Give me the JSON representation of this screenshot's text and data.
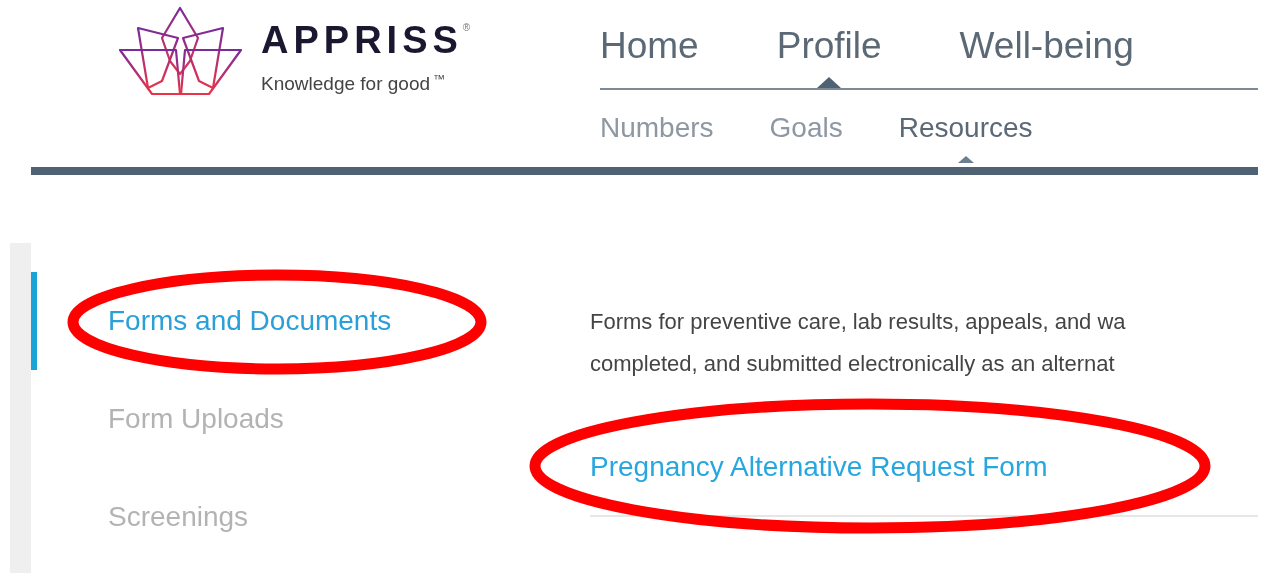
{
  "logo": {
    "name": "APPRISS",
    "registered": "®",
    "tagline": "Knowledge for good",
    "trademark": "™"
  },
  "main_nav": [
    {
      "label": "Home",
      "selected": false
    },
    {
      "label": "Profile",
      "selected": true
    },
    {
      "label": "Well-being",
      "selected": false
    }
  ],
  "sub_nav": [
    {
      "label": "Numbers",
      "selected": false
    },
    {
      "label": "Goals",
      "selected": false
    },
    {
      "label": "Resources",
      "selected": true
    }
  ],
  "sidebar": {
    "items": [
      {
        "label": "Forms and Documents",
        "selected": true
      },
      {
        "label": "Form Uploads",
        "selected": false
      },
      {
        "label": "Screenings",
        "selected": false
      }
    ]
  },
  "content": {
    "description_lines": [
      "Forms for preventive care, lab results, appeals, and wa",
      "completed, and submitted electronically as an alternat"
    ],
    "links": [
      "Pregnancy Alternative Request Form"
    ]
  }
}
